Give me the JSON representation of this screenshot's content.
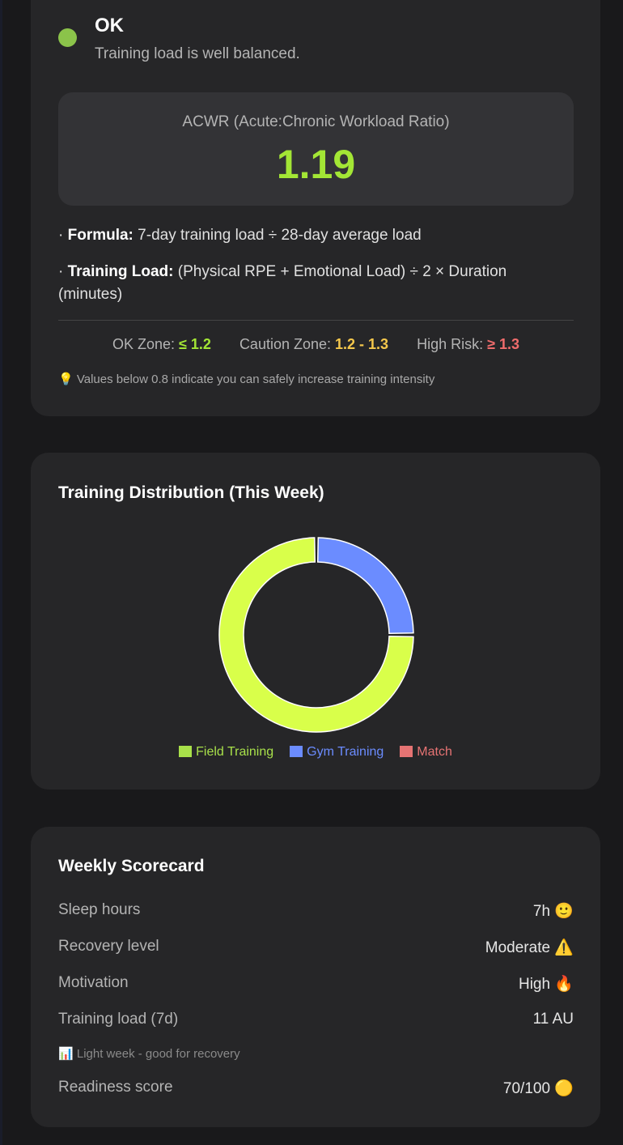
{
  "status": {
    "title": "OK",
    "subtitle": "Training load is well balanced.",
    "color": "#8bc34a"
  },
  "acwr": {
    "label": "ACWR (Acute:Chronic Workload Ratio)",
    "value": "1.19",
    "formula_label": "Formula:",
    "formula_text": " 7-day training load ÷ 28-day average load",
    "load_label": "Training Load:",
    "load_text": " (Physical RPE + Emotional Load) ÷ 2 × Duration (minutes)",
    "bullet": "· ",
    "zones": {
      "ok_label": "OK Zone: ",
      "ok_value": "≤ 1.2",
      "caution_label": "Caution Zone: ",
      "caution_value": "1.2 - 1.3",
      "high_label": "High Risk: ",
      "high_value": "≥ 1.3"
    },
    "hint_icon": "💡",
    "hint_text": " Values below 0.8 indicate you can safely increase training intensity"
  },
  "distribution": {
    "title": "Training Distribution (This Week)",
    "legend": [
      {
        "label": "Field Training",
        "color": "#a8e04a"
      },
      {
        "label": "Gym Training",
        "color": "#6b8cff"
      },
      {
        "label": "Match",
        "color": "#e57373"
      }
    ]
  },
  "chart_data": {
    "type": "pie",
    "categories": [
      "Field Training",
      "Gym Training",
      "Match"
    ],
    "values": [
      75,
      25,
      0
    ],
    "colors": [
      "#d9ff4a",
      "#6b8cff",
      "#e57373"
    ]
  },
  "scorecard": {
    "title": "Weekly Scorecard",
    "rows": [
      {
        "label": "Sleep hours",
        "value": "7h",
        "icon": "🙂"
      },
      {
        "label": "Recovery level",
        "value": "Moderate",
        "icon": "⚠️"
      },
      {
        "label": "Motivation",
        "value": "High",
        "icon": "🔥"
      },
      {
        "label": "Training load (7d)",
        "value": "11 AU",
        "icon": ""
      }
    ],
    "note_icon": "📊",
    "note_text": " Light week - good for recovery",
    "readiness": {
      "label": "Readiness score",
      "value": "70/100",
      "icon": "🟡"
    }
  }
}
